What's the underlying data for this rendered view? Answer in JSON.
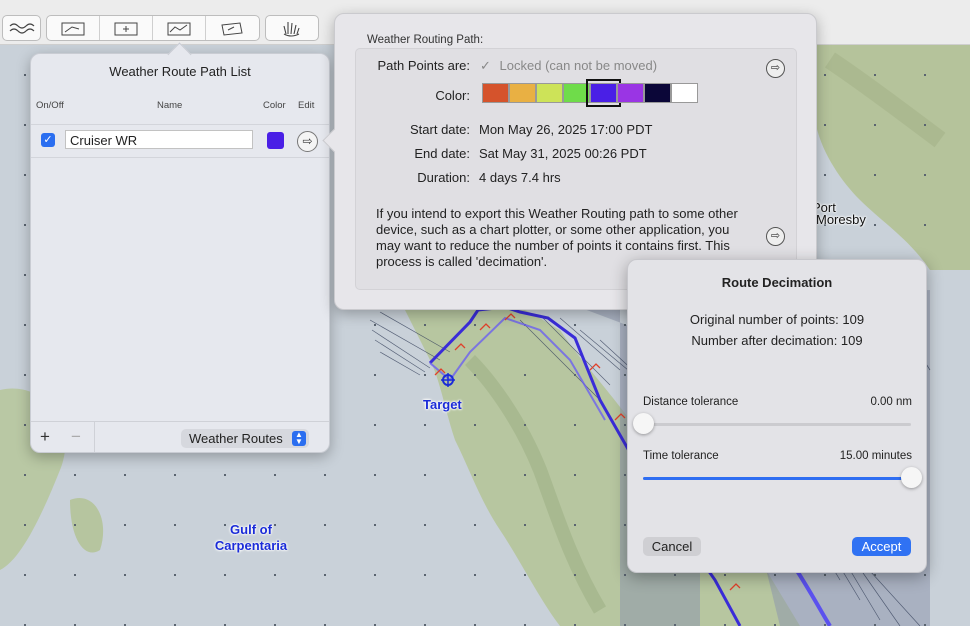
{
  "map": {
    "labels": {
      "target": "Target",
      "gulf_line1": "Gulf of",
      "gulf_line2": "Carpentaria",
      "port_line1": "Port",
      "port_line2": "Moresby"
    }
  },
  "toolbar": {
    "icons": [
      "waves-icon",
      "route-edit-icon",
      "add-route-icon",
      "route-graph-icon",
      "route-note-icon",
      "hand-icon"
    ]
  },
  "route_list": {
    "title": "Weather Route Path List",
    "columns": {
      "on_off": "On/Off",
      "name": "Name",
      "color": "Color",
      "edit": "Edit"
    },
    "rows": [
      {
        "checked": true,
        "name": "Cruiser WR",
        "color": "#4a1fe6"
      }
    ],
    "footer": {
      "add": "+",
      "remove": "−",
      "popup": "Weather Routes"
    }
  },
  "path_details": {
    "header": "Weather Routing Path:",
    "path_points_label": "Path Points are:",
    "locked_text": "Locked (can not be moved)",
    "color_label": "Color:",
    "swatches": [
      "#d5532c",
      "#e9b043",
      "#cde358",
      "#6fdc4a",
      "#4a1fe6",
      "#9a35e4",
      "#0b0638",
      "#ffffff"
    ],
    "selected_swatch": 4,
    "start_label": "Start date:",
    "start_value": "Mon May 26, 2025 17:00 PDT",
    "end_label": "End date:",
    "end_value": "Sat May 31, 2025 00:26 PDT",
    "duration_label": "Duration:",
    "duration_value": "4 days 7.4 hrs",
    "paragraph": "If you intend to export this Weather Routing path to some other device, such as a chart plotter, or some other application, you may want to reduce the number of points it contains first.  This process is called 'decimation'."
  },
  "decimation": {
    "title": "Route Decimation",
    "original": "Original number of points: 109",
    "after": "Number after decimation: 109",
    "distance_label": "Distance tolerance",
    "distance_value": "0.00 nm",
    "distance_fraction": 0.0,
    "time_label": "Time tolerance",
    "time_value": "15.00 minutes",
    "time_fraction": 1.0,
    "cancel": "Cancel",
    "accept": "Accept"
  }
}
